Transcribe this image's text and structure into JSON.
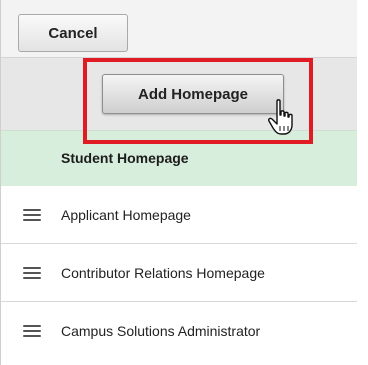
{
  "toolbar": {
    "cancel_label": "Cancel"
  },
  "add": {
    "button_label": "Add Homepage"
  },
  "homepages": {
    "selected": "Student Homepage",
    "items": [
      {
        "label": "Applicant Homepage",
        "icon": "drag-handle-icon"
      },
      {
        "label": "Contributor Relations Homepage",
        "icon": "drag-handle-icon"
      },
      {
        "label": "Campus Solutions Administrator",
        "icon": "drag-handle-icon"
      }
    ]
  },
  "colors": {
    "highlight": "#e01b24",
    "selected_row": "#d8eedd"
  }
}
